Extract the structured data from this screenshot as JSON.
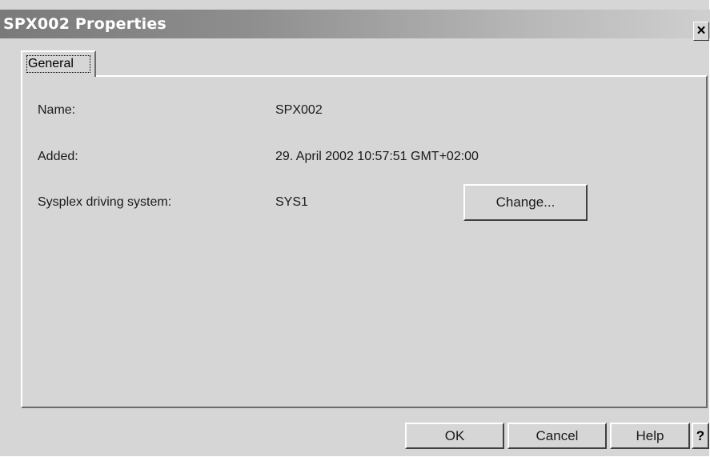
{
  "window": {
    "title": "SPX002 Properties",
    "close_symbol": "×"
  },
  "tabs": [
    {
      "label": "General",
      "selected": true
    }
  ],
  "general": {
    "name_label": "Name:",
    "name_value": "SPX002",
    "added_label": "Added:",
    "added_value": "29. April 2002 10:57:51 GMT+02:00",
    "driving_label": "Sysplex driving system:",
    "driving_value": "SYS1",
    "change_button": "Change..."
  },
  "footer": {
    "ok": "OK",
    "cancel": "Cancel",
    "help": "Help",
    "context_help": "?"
  },
  "icons": {
    "close": "close-icon",
    "context_help": "question-mark-icon"
  }
}
